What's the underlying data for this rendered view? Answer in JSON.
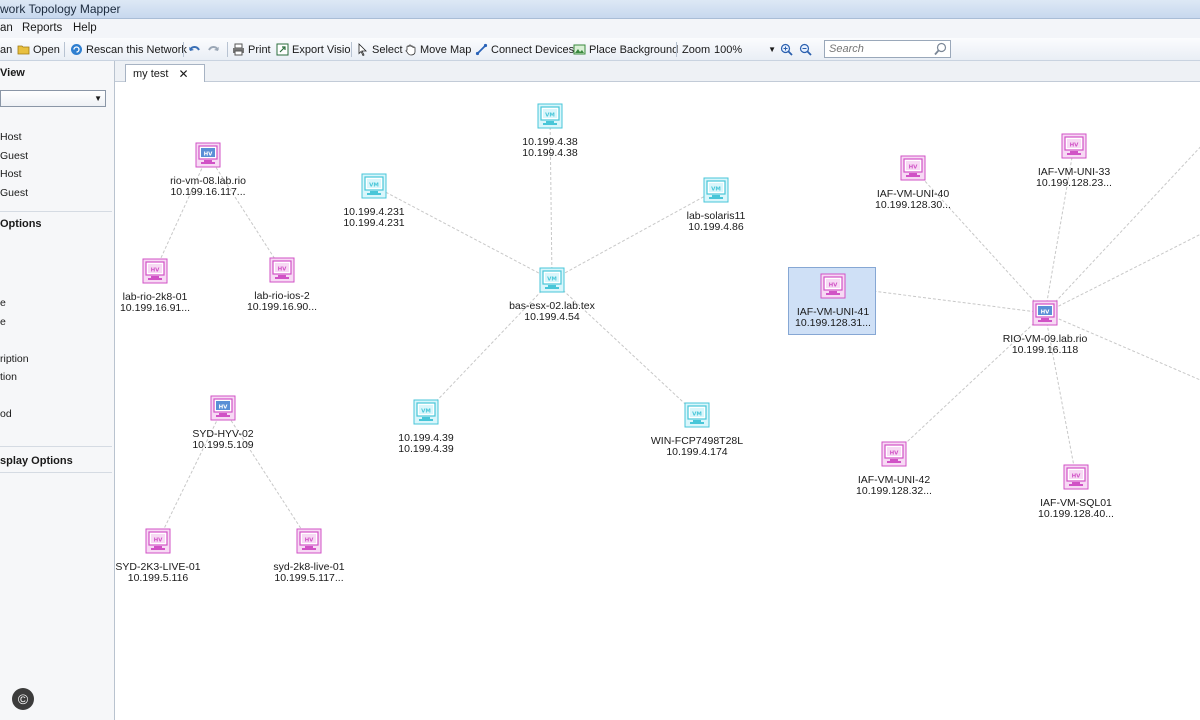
{
  "window": {
    "title": "work Topology Mapper"
  },
  "menu": {
    "items": [
      "an",
      "Reports",
      "Help"
    ]
  },
  "toolbar": {
    "open": "Open",
    "rescan": "Rescan this Network",
    "print": "Print",
    "export_visio": "Export Visio",
    "select": "Select",
    "move_map": "Move Map",
    "connect_devices": "Connect Devices",
    "place_background": "Place Background",
    "zoom_label": "Zoom",
    "zoom_value": "100%",
    "search_placeholder": "Search"
  },
  "left_panel": {
    "view_heading": "View",
    "items_a": [
      "Host",
      "Guest",
      "Host",
      "Guest"
    ],
    "options_heading": "Options",
    "items_b": [
      "e",
      "e",
      "ription",
      "tion",
      "od"
    ],
    "display_heading": "splay Options",
    "copyright": "©"
  },
  "tab": {
    "label": "my test"
  },
  "colors": {
    "vm_node": "#48c6d8",
    "hv_node": "#d152c6",
    "edge": "#c8c8c8",
    "selection": "#cfe0f6"
  },
  "nodes": [
    {
      "id": "n1",
      "type": "vm",
      "name": "10.199.4.38",
      "ip": "10.199.4.38"
    },
    {
      "id": "n2",
      "type": "vm",
      "name": "10.199.4.231",
      "ip": "10.199.4.231"
    },
    {
      "id": "n3",
      "type": "vm",
      "name": "lab-solaris11",
      "ip": "10.199.4.86"
    },
    {
      "id": "n4",
      "type": "vm",
      "name": "bas-esx-02.lab.tex",
      "ip": "10.199.4.54"
    },
    {
      "id": "n5",
      "type": "vm",
      "name": "10.199.4.39",
      "ip": "10.199.4.39"
    },
    {
      "id": "n6",
      "type": "vm",
      "name": "WIN-FCP7498T28L",
      "ip": "10.199.4.174"
    },
    {
      "id": "n7",
      "type": "hv-host",
      "name": "rio-vm-08.lab.rio",
      "ip": "10.199.16.117..."
    },
    {
      "id": "n8",
      "type": "hv",
      "name": "lab-rio-2k8-01",
      "ip": "10.199.16.91..."
    },
    {
      "id": "n9",
      "type": "hv",
      "name": "lab-rio-ios-2",
      "ip": "10.199.16.90..."
    },
    {
      "id": "n10",
      "type": "hv-host",
      "name": "SYD-HYV-02",
      "ip": "10.199.5.109"
    },
    {
      "id": "n11",
      "type": "hv",
      "name": "SYD-2K3-LIVE-01",
      "ip": "10.199.5.116"
    },
    {
      "id": "n12",
      "type": "hv",
      "name": "syd-2k8-live-01",
      "ip": "10.199.5.117..."
    },
    {
      "id": "n13",
      "type": "hv",
      "name": "IAF-VM-UNI-40",
      "ip": "10.199.128.30..."
    },
    {
      "id": "n14",
      "type": "hv",
      "name": "IAF-VM-UNI-33",
      "ip": "10.199.128.23..."
    },
    {
      "id": "n15",
      "type": "hv",
      "name": "IAF-VM-UNI-41",
      "ip": "10.199.128.31...",
      "selected": true
    },
    {
      "id": "n16",
      "type": "hv-host",
      "name": "RIO-VM-09.lab.rio",
      "ip": "10.199.16.118"
    },
    {
      "id": "n17",
      "type": "hv",
      "name": "IAF-VM-UNI-42",
      "ip": "10.199.128.32..."
    },
    {
      "id": "n18",
      "type": "hv",
      "name": "IAF-VM-SQL01",
      "ip": "10.199.128.40..."
    }
  ],
  "edges": [
    [
      "n4",
      "n1"
    ],
    [
      "n4",
      "n2"
    ],
    [
      "n4",
      "n3"
    ],
    [
      "n4",
      "n5"
    ],
    [
      "n4",
      "n6"
    ],
    [
      "n7",
      "n8"
    ],
    [
      "n7",
      "n9"
    ],
    [
      "n10",
      "n11"
    ],
    [
      "n10",
      "n12"
    ],
    [
      "n16",
      "n13"
    ],
    [
      "n16",
      "n14"
    ],
    [
      "n16",
      "n15"
    ],
    [
      "n16",
      "n17"
    ],
    [
      "n16",
      "n18"
    ],
    [
      "n16",
      "offright1"
    ],
    [
      "n16",
      "offright2"
    ],
    [
      "n16",
      "offright3"
    ]
  ]
}
